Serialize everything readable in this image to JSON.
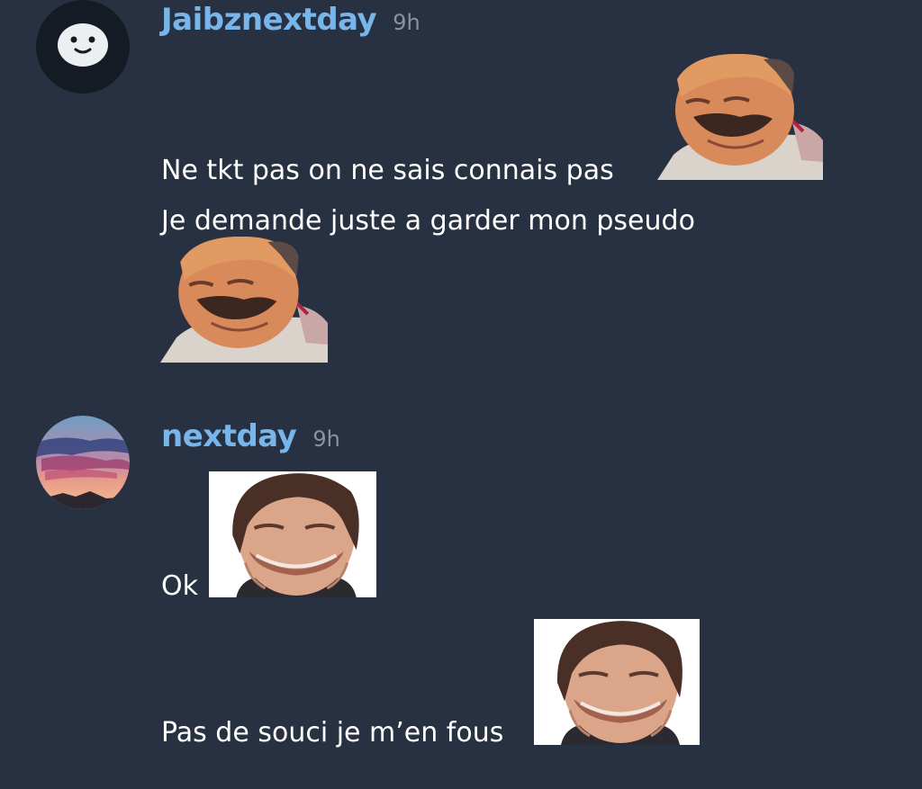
{
  "colors": {
    "background": "#283141",
    "username": "#78b5ea",
    "timestamp": "#8a93a3",
    "message_text": "#ffffff"
  },
  "messages": [
    {
      "author": "Jaibznextday",
      "time": "9h",
      "avatar_icon": "ghost-face-icon",
      "lines": [
        {
          "text": "Ne tkt pas on ne sais connais pas",
          "emote": "laughing-man-emote"
        },
        {
          "text": "Je demande juste a garder mon pseudo",
          "emote": "laughing-man-emote"
        }
      ]
    },
    {
      "author": "nextday",
      "time": "9h",
      "avatar_icon": "sunset-sky-avatar",
      "lines": [
        {
          "text": "Ok",
          "emote": "grinning-man-emote"
        },
        {
          "text": "Pas de souci je m’en fous",
          "emote": "grinning-man-emote"
        }
      ]
    }
  ]
}
